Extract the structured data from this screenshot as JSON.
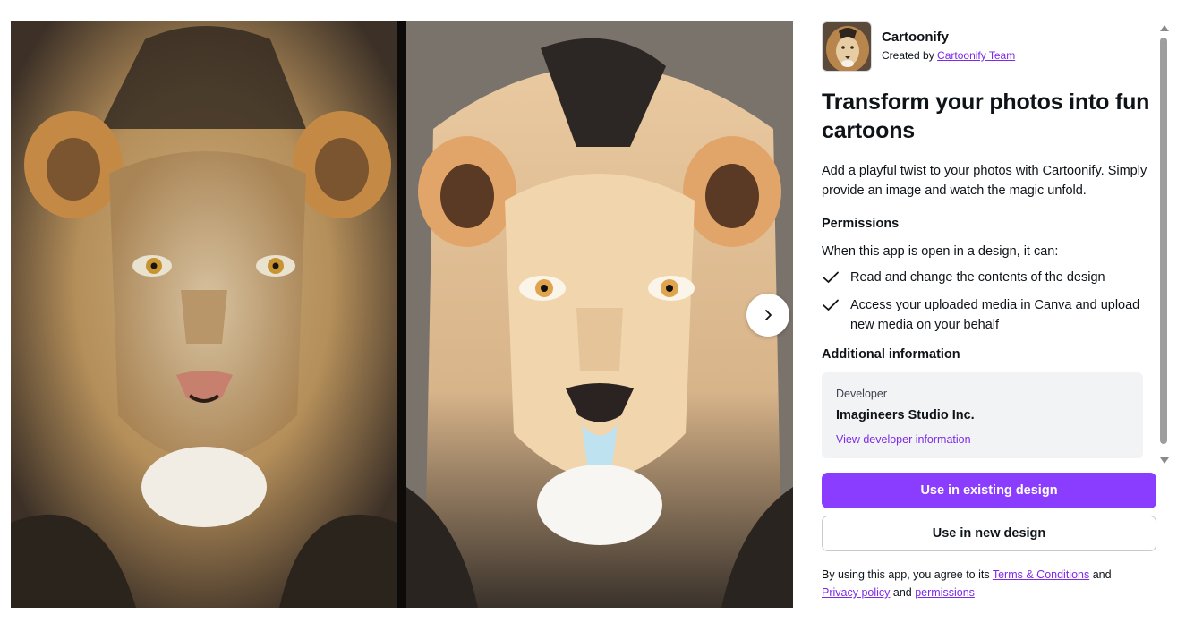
{
  "app": {
    "name": "Cartoonify",
    "created_by_prefix": "Created by ",
    "creator": "Cartoonify Team"
  },
  "headline": "Transform your photos into fun cartoons",
  "description": "Add a playful twist to your photos with Cartoonify. Simply provide an image and watch the magic unfold.",
  "permissions": {
    "title": "Permissions",
    "intro": "When this app is open in a design, it can:",
    "items": [
      "Read and change the contents of the design",
      "Access your uploaded media in Canva and upload new media on your behalf"
    ]
  },
  "additional": {
    "title": "Additional information",
    "developer_label": "Developer",
    "developer_name": "Imagineers Studio Inc.",
    "developer_link": "View developer information"
  },
  "buttons": {
    "use_existing": "Use in existing design",
    "use_new": "Use in new design"
  },
  "legal": {
    "prefix": "By using this app, you agree to its ",
    "terms": "Terms & Conditions",
    "and1": " and ",
    "privacy": "Privacy policy",
    "and2": " and ",
    "permissions": "permissions"
  },
  "icons": {
    "next": "chevron-right-icon",
    "check": "check-icon"
  },
  "colors": {
    "accent": "#8b3dff",
    "link": "#7d2ae8",
    "info_box": "#f2f3f5"
  }
}
